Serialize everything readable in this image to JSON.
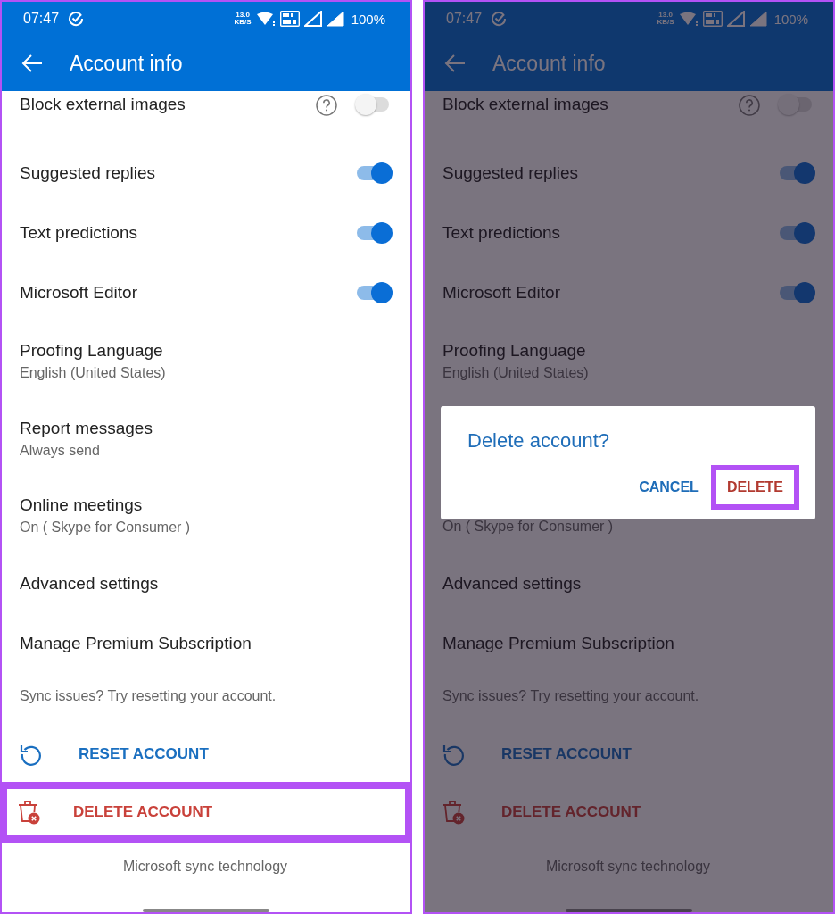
{
  "screens": [
    {
      "status_bar": {
        "time": "07:47",
        "speed": "13.0",
        "speed_unit": "KB/S",
        "battery": "100%"
      },
      "app_bar": {
        "title": "Account info"
      },
      "dimmed": false,
      "items": [
        {
          "kind": "toggle",
          "title": "Block external images",
          "help": true,
          "on": false
        },
        {
          "kind": "toggle",
          "title": "Suggested replies",
          "help": false,
          "on": true
        },
        {
          "kind": "toggle",
          "title": "Text predictions",
          "help": false,
          "on": true
        },
        {
          "kind": "toggle",
          "title": "Microsoft Editor",
          "help": false,
          "on": true
        },
        {
          "kind": "detail",
          "title": "Proofing Language",
          "subtitle": "English (United States)"
        },
        {
          "kind": "detail",
          "title": "Report messages",
          "subtitle": "Always send"
        },
        {
          "kind": "detail",
          "title": "Online meetings",
          "subtitle": "On ( Skype for Consumer )"
        },
        {
          "kind": "link",
          "title": "Advanced settings"
        },
        {
          "kind": "link",
          "title": "Manage Premium Subscription"
        },
        {
          "kind": "note",
          "text": "Sync issues? Try resetting your account."
        },
        {
          "kind": "reset",
          "label": "RESET ACCOUNT",
          "highlighted": false
        },
        {
          "kind": "delete",
          "label": "DELETE ACCOUNT",
          "highlighted": true
        },
        {
          "kind": "footer",
          "text": "Microsoft sync technology"
        }
      ]
    },
    {
      "status_bar": {
        "time": "07:47",
        "speed": "13.0",
        "speed_unit": "KB/S",
        "battery": "100%"
      },
      "app_bar": {
        "title": "Account info"
      },
      "dimmed": true,
      "items": [
        {
          "kind": "toggle",
          "title": "Block external images",
          "help": true,
          "on": false
        },
        {
          "kind": "toggle",
          "title": "Suggested replies",
          "help": false,
          "on": true
        },
        {
          "kind": "toggle",
          "title": "Text predictions",
          "help": false,
          "on": true
        },
        {
          "kind": "toggle",
          "title": "Microsoft Editor",
          "help": false,
          "on": true
        },
        {
          "kind": "detail",
          "title": "Proofing Language",
          "subtitle": "English (United States)"
        },
        {
          "kind": "dialog",
          "title": "Delete account?",
          "buttons": [
            {
              "label": "CANCEL",
              "kind": "cancel",
              "highlighted": false
            },
            {
              "label": "DELETE",
              "kind": "delete",
              "highlighted": true
            }
          ]
        },
        {
          "kind": "detail",
          "subtitle": "On ( Skype for Consumer )"
        },
        {
          "kind": "link",
          "title": "Advanced settings"
        },
        {
          "kind": "link",
          "title": "Manage Premium Subscription"
        },
        {
          "kind": "note",
          "text": "Sync issues? Try resetting your account."
        },
        {
          "kind": "reset",
          "label": "RESET ACCOUNT",
          "highlighted": false
        },
        {
          "kind": "delete",
          "label": "DELETE ACCOUNT",
          "highlighted": false
        },
        {
          "kind": "footer",
          "text": "Microsoft sync technology"
        }
      ]
    }
  ]
}
